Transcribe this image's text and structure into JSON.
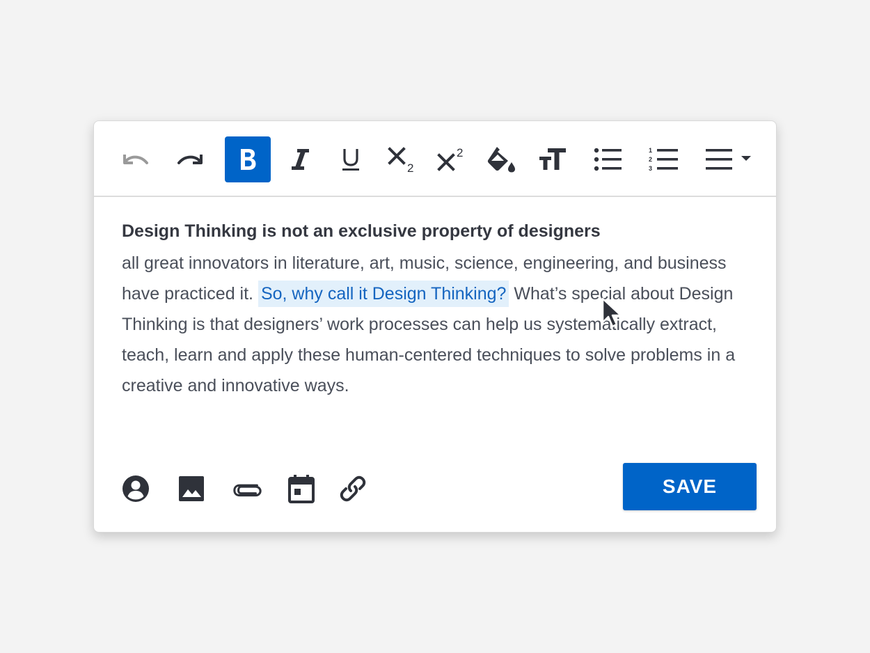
{
  "toolbar": {
    "items": [
      {
        "icon": "undo-icon",
        "state": "disabled"
      },
      {
        "icon": "redo-icon",
        "state": "enabled"
      },
      {
        "icon": "bold-icon",
        "state": "active"
      },
      {
        "icon": "italic-icon",
        "state": "enabled"
      },
      {
        "icon": "underline-icon",
        "state": "enabled"
      },
      {
        "icon": "subscript-icon",
        "state": "enabled"
      },
      {
        "icon": "superscript-icon",
        "state": "enabled"
      },
      {
        "icon": "fill-color-icon",
        "state": "enabled"
      },
      {
        "icon": "text-size-icon",
        "state": "enabled"
      },
      {
        "icon": "bulleted-list-icon",
        "state": "enabled"
      },
      {
        "icon": "numbered-list-icon",
        "state": "enabled"
      },
      {
        "icon": "align-dropdown-icon",
        "state": "enabled"
      }
    ]
  },
  "editor": {
    "heading": "Design Thinking is not an exclusive property of designers",
    "text_before": "all great innovators in literature, art, music, science, engineering, and business have practiced it.",
    "highlighted": "So, why call it Design Thinking?",
    "text_after": "What’s special about Design Thinking is that designers’ work processes can help us systematically extract, teach, learn and apply these human-centered techniques to solve problems in a creative and innovative ways."
  },
  "footer": {
    "icons": [
      "account-icon",
      "image-icon",
      "attachment-icon",
      "calendar-icon",
      "link-icon"
    ],
    "save_label": "SAVE"
  },
  "colors": {
    "accent": "#0064c8",
    "icon": "#2f323a",
    "icon_disabled": "#9a9a9a",
    "highlight_bg": "#e2f0fb",
    "highlight_text": "#1565c0",
    "body_text": "#4a4f5a",
    "background": "#f3f3f3"
  }
}
